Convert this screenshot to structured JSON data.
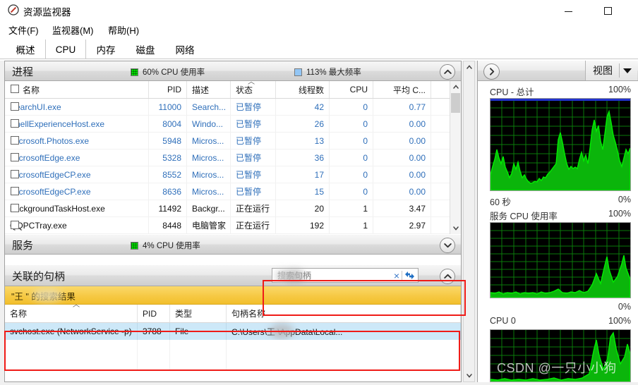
{
  "window": {
    "title": "资源监视器",
    "icon": "resource-monitor-icon",
    "minimize_label": "最小化",
    "maximize_label": "最大化"
  },
  "menu": {
    "items": [
      {
        "label": "文件(F)"
      },
      {
        "label": "监视器(M)"
      },
      {
        "label": "帮助(H)"
      }
    ]
  },
  "tabs": {
    "items": [
      {
        "label": "概述",
        "active": false
      },
      {
        "label": "CPU",
        "active": true
      },
      {
        "label": "内存",
        "active": false
      },
      {
        "label": "磁盘",
        "active": false
      },
      {
        "label": "网络",
        "active": false
      }
    ]
  },
  "processes": {
    "title": "进程",
    "legend": [
      {
        "label": "60% CPU 使用率",
        "color": "#00e000"
      },
      {
        "label": "113% 最大频率",
        "color": "#93c6f5"
      }
    ],
    "collapse_icon": "chevron-up-icon",
    "columns": [
      {
        "label": "名称",
        "align": "txt"
      },
      {
        "label": "PID",
        "align": "num"
      },
      {
        "label": "描述",
        "align": "txt"
      },
      {
        "label": "状态",
        "align": "txt",
        "sorted": true
      },
      {
        "label": "线程数",
        "align": "num"
      },
      {
        "label": "CPU",
        "align": "num"
      },
      {
        "label": "平均 C...",
        "align": "num"
      }
    ],
    "rows": [
      {
        "name": "SearchUI.exe",
        "pid": "11000",
        "desc": "Search...",
        "status": "已暂停",
        "threads": "42",
        "cpu": "0",
        "avg": "0.77",
        "state": "suspended"
      },
      {
        "name": "ShellExperienceHost.exe",
        "pid": "8004",
        "desc": "Windo...",
        "status": "已暂停",
        "threads": "26",
        "cpu": "0",
        "avg": "0.00",
        "state": "suspended"
      },
      {
        "name": "Microsoft.Photos.exe",
        "pid": "5948",
        "desc": "Micros...",
        "status": "已暂停",
        "threads": "13",
        "cpu": "0",
        "avg": "0.00",
        "state": "suspended"
      },
      {
        "name": "MicrosoftEdge.exe",
        "pid": "5328",
        "desc": "Micros...",
        "status": "已暂停",
        "threads": "36",
        "cpu": "0",
        "avg": "0.00",
        "state": "suspended"
      },
      {
        "name": "MicrosoftEdgeCP.exe",
        "pid": "8552",
        "desc": "Micros...",
        "status": "已暂停",
        "threads": "17",
        "cpu": "0",
        "avg": "0.00",
        "state": "suspended"
      },
      {
        "name": "MicrosoftEdgeCP.exe",
        "pid": "8636",
        "desc": "Micros...",
        "status": "已暂停",
        "threads": "15",
        "cpu": "0",
        "avg": "0.00",
        "state": "suspended"
      },
      {
        "name": "backgroundTaskHost.exe",
        "pid": "11492",
        "desc": "Backgr...",
        "status": "正在运行",
        "threads": "20",
        "cpu": "1",
        "avg": "3.47",
        "state": "running"
      },
      {
        "name": "QQPCTray.exe",
        "pid": "8448",
        "desc": "电脑管家",
        "status": "正在运行",
        "threads": "192",
        "cpu": "1",
        "avg": "2.97",
        "state": "running"
      }
    ],
    "scroll_up_icon": "chevron-up-icon",
    "scroll_down_icon": "chevron-down-icon"
  },
  "services": {
    "title": "服务",
    "legend_label": "4% CPU 使用率",
    "legend_color": "#00b000",
    "expand_icon": "chevron-down-icon"
  },
  "handles": {
    "title": "关联的句柄",
    "search_value": "",
    "search_placeholder": "搜索句柄",
    "clear_icon": "clear-x-icon",
    "refresh_icon": "refresh-icon",
    "collapse_icon": "chevron-up-icon",
    "result_banner": "\"王     \" 的搜索结果",
    "columns": [
      {
        "label": "名称",
        "sorted": true
      },
      {
        "label": "PID"
      },
      {
        "label": "类型"
      },
      {
        "label": "句柄名称"
      }
    ],
    "rows": [
      {
        "name": "svchost.exe (NetworkService -p)",
        "pid": "3788",
        "type": "File",
        "handle_name": "C:\\Users\\王     \\AppData\\Local..."
      }
    ]
  },
  "graphs": {
    "expand_icon": "chevron-right-icon",
    "view_label": "视图",
    "view_caret": "caret-down-icon",
    "panels": [
      {
        "title": "CPU - 总计",
        "top": "100%",
        "bottom_left": "60 秒",
        "bottom_right": "0%"
      },
      {
        "title": "服务 CPU 使用率",
        "top": "100%",
        "bottom_left": "",
        "bottom_right": "0%"
      },
      {
        "title": "CPU 0",
        "top": "100%",
        "bottom_left": "",
        "bottom_right": ""
      }
    ]
  },
  "watermark": "CSDN @一只小小狗",
  "colors": {
    "accent_blue": "#2f6fba",
    "graph_green": "#00e000",
    "graph_bg": "#000000",
    "annotation_red": "#ef1b17",
    "banner_yellow": "#f6c944",
    "selection_blue": "#cde8f8"
  }
}
